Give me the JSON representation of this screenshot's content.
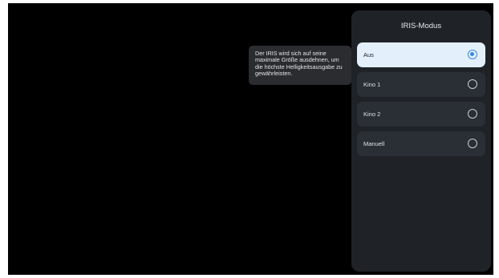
{
  "tooltip": {
    "text": "Der IRIS wird sich auf seine maximale Größe ausdehnen, um die höchste Helligkeitsausgabe zu gewährleisten."
  },
  "panel": {
    "title": "IRIS-Modus",
    "options": [
      {
        "label": "Aus",
        "selected": true
      },
      {
        "label": "Kino 1",
        "selected": false
      },
      {
        "label": "Kino 2",
        "selected": false
      },
      {
        "label": "Manuell",
        "selected": false
      }
    ]
  },
  "colors": {
    "background": "#000000",
    "panel": "#1f2328",
    "option": "#2a2f36",
    "selected_option": "#e3f0fb",
    "accent": "#3a88e6"
  }
}
